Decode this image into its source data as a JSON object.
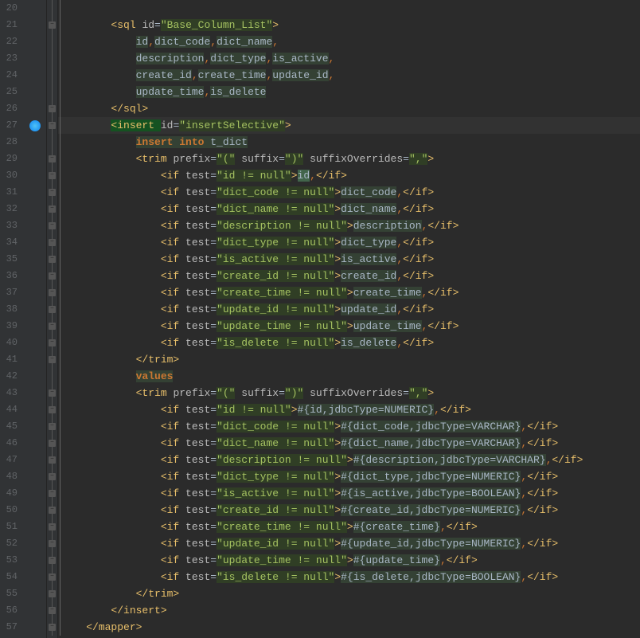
{
  "startLine": 20,
  "lines": [
    {
      "n": 20,
      "indent": 0,
      "html": ""
    },
    {
      "n": 21,
      "indent": 4,
      "html": "<span class='tag'>&lt;sql </span><span class='attr'>id</span><span class='eq'>=</span><span class='val'>\"Base_Column_List\"</span><span class='tag'>&gt;</span>",
      "fold": "minus"
    },
    {
      "n": 22,
      "indent": 8,
      "html": "<span class='ident'>id</span><span class='punct'>,</span><span class='ident'>dict_code</span><span class='punct'>,</span><span class='ident'>dict_name</span><span class='punct'>,</span>"
    },
    {
      "n": 23,
      "indent": 8,
      "html": "<span class='ident'>description</span><span class='punct'>,</span><span class='ident'>dict_type</span><span class='punct'>,</span><span class='ident'>is_active</span><span class='punct'>,</span>"
    },
    {
      "n": 24,
      "indent": 8,
      "html": "<span class='ident'>create_id</span><span class='punct'>,</span><span class='ident'>create_time</span><span class='punct'>,</span><span class='ident'>update_id</span><span class='punct'>,</span>"
    },
    {
      "n": 25,
      "indent": 8,
      "html": "<span class='ident'>update_time</span><span class='punct'>,</span><span class='ident'>is_delete</span>"
    },
    {
      "n": 26,
      "indent": 4,
      "html": "<span class='tag'>&lt;/sql&gt;</span>",
      "fold": "end"
    },
    {
      "n": 27,
      "indent": 4,
      "html": "<span class='tag' style='background:#155221'>&lt;insert </span><span class='attr'>id</span><span class='eq'>=</span><span class='val'>\"insertSelective\"</span><span class='tag'>&gt;</span>",
      "fold": "minus",
      "icon": true,
      "current": true
    },
    {
      "n": 28,
      "indent": 8,
      "html": "<span class='kw-bg'>insert </span><span class='kw-bg'>into</span><span class='ident'> t_dict</span>"
    },
    {
      "n": 29,
      "indent": 8,
      "html": "<span class='tag'>&lt;trim </span><span class='attr'>prefix</span><span class='eq'>=</span><span class='val'>\"(\"</span><span class='tag'> </span><span class='attr'>suffix</span><span class='eq'>=</span><span class='val'>\")\"</span><span class='tag'> </span><span class='attr'>suffixOverrides</span><span class='eq'>=</span><span class='val'>\",\"</span><span class='tag'>&gt;</span>",
      "fold": "minus"
    },
    {
      "n": 30,
      "indent": 12,
      "html": "<span class='tag'>&lt;if </span><span class='attr'>test</span><span class='eq'>=</span><span class='val'>\"id != null\"</span><span class='tag'>&gt;</span><span class='ident' style='background:#42654B'>id</span><span class='punct'>,</span><span class='tag'>&lt;/if&gt;</span>",
      "fold": "inline"
    },
    {
      "n": 31,
      "indent": 12,
      "html": "<span class='tag'>&lt;if </span><span class='attr'>test</span><span class='eq'>=</span><span class='val'>\"dict_code != null\"</span><span class='tag'>&gt;</span><span class='ident'>dict_code</span><span class='punct'>,</span><span class='tag'>&lt;/if&gt;</span>",
      "fold": "inline"
    },
    {
      "n": 32,
      "indent": 12,
      "html": "<span class='tag'>&lt;if </span><span class='attr'>test</span><span class='eq'>=</span><span class='val'>\"dict_name != null\"</span><span class='tag'>&gt;</span><span class='ident'>dict_name</span><span class='punct'>,</span><span class='tag'>&lt;/if&gt;</span>",
      "fold": "inline"
    },
    {
      "n": 33,
      "indent": 12,
      "html": "<span class='tag'>&lt;if </span><span class='attr'>test</span><span class='eq'>=</span><span class='val'>\"description != null\"</span><span class='tag'>&gt;</span><span class='ident'>description</span><span class='punct'>,</span><span class='tag'>&lt;/if&gt;</span>",
      "fold": "inline"
    },
    {
      "n": 34,
      "indent": 12,
      "html": "<span class='tag'>&lt;if </span><span class='attr'>test</span><span class='eq'>=</span><span class='val'>\"dict_type != null\"</span><span class='tag'>&gt;</span><span class='ident'>dict_type</span><span class='punct'>,</span><span class='tag'>&lt;/if&gt;</span>",
      "fold": "inline"
    },
    {
      "n": 35,
      "indent": 12,
      "html": "<span class='tag'>&lt;if </span><span class='attr'>test</span><span class='eq'>=</span><span class='val'>\"is_active != null\"</span><span class='tag'>&gt;</span><span class='ident'>is_active</span><span class='punct'>,</span><span class='tag'>&lt;/if&gt;</span>",
      "fold": "inline"
    },
    {
      "n": 36,
      "indent": 12,
      "html": "<span class='tag'>&lt;if </span><span class='attr'>test</span><span class='eq'>=</span><span class='val'>\"create_id != null\"</span><span class='tag'>&gt;</span><span class='ident'>create_id</span><span class='punct'>,</span><span class='tag'>&lt;/if&gt;</span>",
      "fold": "inline"
    },
    {
      "n": 37,
      "indent": 12,
      "html": "<span class='tag'>&lt;if </span><span class='attr'>test</span><span class='eq'>=</span><span class='val'>\"create_time != null\"</span><span class='tag'>&gt;</span><span class='ident'>create_time</span><span class='punct'>,</span><span class='tag'>&lt;/if&gt;</span>",
      "fold": "inline"
    },
    {
      "n": 38,
      "indent": 12,
      "html": "<span class='tag'>&lt;if </span><span class='attr'>test</span><span class='eq'>=</span><span class='val'>\"update_id != null\"</span><span class='tag'>&gt;</span><span class='ident'>update_id</span><span class='punct'>,</span><span class='tag'>&lt;/if&gt;</span>",
      "fold": "inline"
    },
    {
      "n": 39,
      "indent": 12,
      "html": "<span class='tag'>&lt;if </span><span class='attr'>test</span><span class='eq'>=</span><span class='val'>\"update_time != null\"</span><span class='tag'>&gt;</span><span class='ident'>update_time</span><span class='punct'>,</span><span class='tag'>&lt;/if&gt;</span>",
      "fold": "inline"
    },
    {
      "n": 40,
      "indent": 12,
      "html": "<span class='tag'>&lt;if </span><span class='attr'>test</span><span class='eq'>=</span><span class='val'>\"is_delete != null\"</span><span class='tag'>&gt;</span><span class='ident'>is_delete</span><span class='punct'>,</span><span class='tag'>&lt;/if&gt;</span>",
      "fold": "inline"
    },
    {
      "n": 41,
      "indent": 8,
      "html": "<span class='tag'>&lt;/trim&gt;</span>",
      "fold": "end"
    },
    {
      "n": 42,
      "indent": 8,
      "html": "<span class='kw-bg'>values</span>"
    },
    {
      "n": 43,
      "indent": 8,
      "html": "<span class='tag'>&lt;trim </span><span class='attr'>prefix</span><span class='eq'>=</span><span class='val'>\"(\"</span><span class='tag'> </span><span class='attr'>suffix</span><span class='eq'>=</span><span class='val'>\")\"</span><span class='tag'> </span><span class='attr'>suffixOverrides</span><span class='eq'>=</span><span class='val'>\",\"</span><span class='tag'>&gt;</span>",
      "fold": "minus"
    },
    {
      "n": 44,
      "indent": 12,
      "html": "<span class='tag'>&lt;if </span><span class='attr'>test</span><span class='eq'>=</span><span class='val'>\"id != null\"</span><span class='tag'>&gt;</span><span class='expr'>#{id,jdbcType=NUMERIC}</span><span class='punct'>,</span><span class='tag'>&lt;/if&gt;</span>",
      "fold": "inline"
    },
    {
      "n": 45,
      "indent": 12,
      "html": "<span class='tag'>&lt;if </span><span class='attr'>test</span><span class='eq'>=</span><span class='val'>\"dict_code != null\"</span><span class='tag'>&gt;</span><span class='expr'>#{dict_code,jdbcType=VARCHAR}</span><span class='punct'>,</span><span class='tag'>&lt;/if&gt;</span>",
      "fold": "inline"
    },
    {
      "n": 46,
      "indent": 12,
      "html": "<span class='tag'>&lt;if </span><span class='attr'>test</span><span class='eq'>=</span><span class='val'>\"dict_name != null\"</span><span class='tag'>&gt;</span><span class='expr'>#{dict_name,jdbcType=VARCHAR}</span><span class='punct'>,</span><span class='tag'>&lt;/if&gt;</span>",
      "fold": "inline"
    },
    {
      "n": 47,
      "indent": 12,
      "html": "<span class='tag'>&lt;if </span><span class='attr'>test</span><span class='eq'>=</span><span class='val'>\"description != null\"</span><span class='tag'>&gt;</span><span class='expr'>#{description,jdbcType=VARCHAR}</span><span class='punct'>,</span><span class='tag'>&lt;/if&gt;</span>",
      "fold": "inline"
    },
    {
      "n": 48,
      "indent": 12,
      "html": "<span class='tag'>&lt;if </span><span class='attr'>test</span><span class='eq'>=</span><span class='val'>\"dict_type != null\"</span><span class='tag'>&gt;</span><span class='expr'>#{dict_type,jdbcType=NUMERIC}</span><span class='punct'>,</span><span class='tag'>&lt;/if&gt;</span>",
      "fold": "inline"
    },
    {
      "n": 49,
      "indent": 12,
      "html": "<span class='tag'>&lt;if </span><span class='attr'>test</span><span class='eq'>=</span><span class='val'>\"is_active != null\"</span><span class='tag'>&gt;</span><span class='expr'>#{is_active,jdbcType=BOOLEAN}</span><span class='punct'>,</span><span class='tag'>&lt;/if&gt;</span>",
      "fold": "inline"
    },
    {
      "n": 50,
      "indent": 12,
      "html": "<span class='tag'>&lt;if </span><span class='attr'>test</span><span class='eq'>=</span><span class='val'>\"create_id != null\"</span><span class='tag'>&gt;</span><span class='expr'>#{create_id,jdbcType=NUMERIC}</span><span class='punct'>,</span><span class='tag'>&lt;/if&gt;</span>",
      "fold": "inline"
    },
    {
      "n": 51,
      "indent": 12,
      "html": "<span class='tag'>&lt;if </span><span class='attr'>test</span><span class='eq'>=</span><span class='val'>\"create_time != null\"</span><span class='tag'>&gt;</span><span class='expr'>#{create_time}</span><span class='punct'>,</span><span class='tag'>&lt;/if&gt;</span>",
      "fold": "inline"
    },
    {
      "n": 52,
      "indent": 12,
      "html": "<span class='tag'>&lt;if </span><span class='attr'>test</span><span class='eq'>=</span><span class='val'>\"update_id != null\"</span><span class='tag'>&gt;</span><span class='expr'>#{update_id,jdbcType=NUMERIC}</span><span class='punct'>,</span><span class='tag'>&lt;/if&gt;</span>",
      "fold": "inline"
    },
    {
      "n": 53,
      "indent": 12,
      "html": "<span class='tag'>&lt;if </span><span class='attr'>test</span><span class='eq'>=</span><span class='val'>\"update_time != null\"</span><span class='tag'>&gt;</span><span class='expr'>#{update_time}</span><span class='punct'>,</span><span class='tag'>&lt;/if&gt;</span>",
      "fold": "inline"
    },
    {
      "n": 54,
      "indent": 12,
      "html": "<span class='tag'>&lt;if </span><span class='attr'>test</span><span class='eq'>=</span><span class='val'>\"is_delete != null\"</span><span class='tag'>&gt;</span><span class='expr'>#{is_delete,jdbcType=BOOLEAN}</span><span class='punct'>,</span><span class='tag'>&lt;/if&gt;</span>",
      "fold": "inline"
    },
    {
      "n": 55,
      "indent": 8,
      "html": "<span class='tag'>&lt;/trim&gt;</span>",
      "fold": "end"
    },
    {
      "n": 56,
      "indent": 4,
      "html": "<span class='tag'>&lt;/insert&gt;</span>",
      "fold": "end"
    },
    {
      "n": 57,
      "indent": 0,
      "html": "<span class='tag'>&lt;/mapper&gt;</span>",
      "fold": "end"
    }
  ]
}
